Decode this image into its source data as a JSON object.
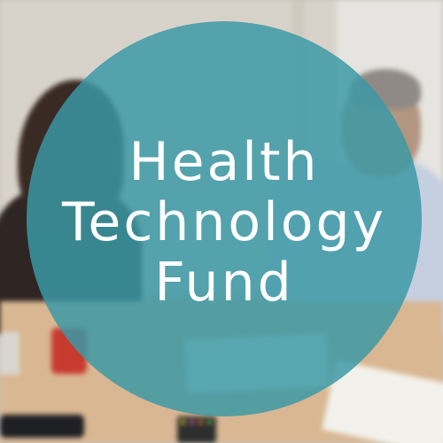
{
  "graphic": {
    "title_lines": [
      "Health",
      "Technology",
      "Fund"
    ],
    "circle_color": "#3a98a6",
    "text_color": "#ffffff"
  },
  "background": {
    "description_type": "blurred-office-meeting-photo"
  }
}
